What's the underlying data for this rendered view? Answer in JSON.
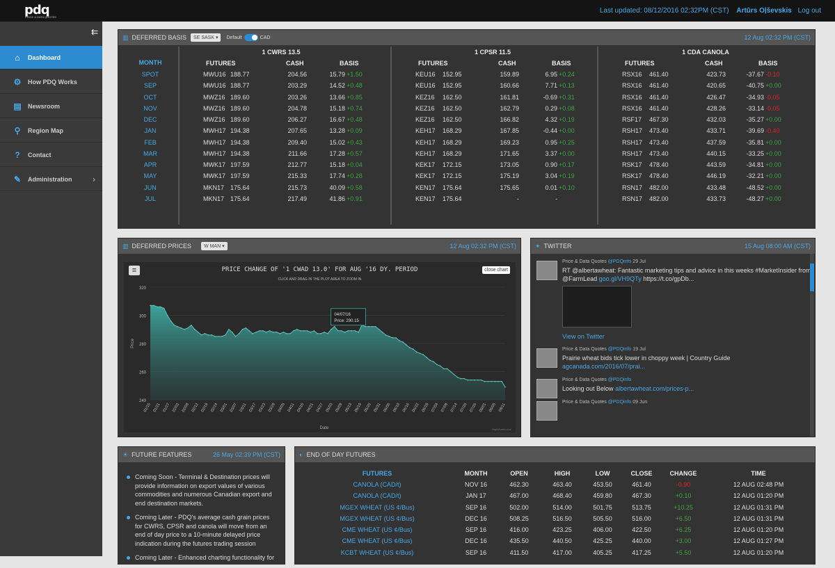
{
  "topbar": {
    "logo": "pdq",
    "logo_sub": "PRICE & DATA QUOTES",
    "last_updated": "Last updated: 08/12/2016 02:32PM (CST)",
    "user": "Artūrs Oļševskis",
    "logout": "Log out"
  },
  "nav": [
    {
      "label": "Dashboard",
      "icon": "home-icon"
    },
    {
      "label": "How PDQ Works",
      "icon": "gears-icon"
    },
    {
      "label": "Newsroom",
      "icon": "newspaper-icon"
    },
    {
      "label": "Region Map",
      "icon": "map-pin-icon"
    },
    {
      "label": "Contact",
      "icon": "question-icon"
    },
    {
      "label": "Administration",
      "icon": "wrench-icon"
    }
  ],
  "basis": {
    "title": "DEFERRED BASIS",
    "region": "SE SASK",
    "toggle_left": "Default",
    "toggle_right": "CAD",
    "timestamp": "12 Aug 02:32 PM (CST)",
    "month_header": "MONTH",
    "months": [
      "SPOT",
      "SEP",
      "OCT",
      "NOV",
      "DEC",
      "JAN",
      "FEB",
      "MAR",
      "APR",
      "MAY",
      "JUN",
      "JUL"
    ],
    "groups": [
      {
        "name": "1 CWRS 13.5",
        "headers": [
          "FUTURES",
          "CASH",
          "BASIS"
        ],
        "rows": [
          [
            "MWU16",
            "188.77",
            "204.56",
            "15.79",
            "+1.50"
          ],
          [
            "MWU16",
            "188.77",
            "203.29",
            "14.52",
            "+0.48"
          ],
          [
            "MWZ16",
            "189.60",
            "203.26",
            "13.66",
            "+0.85"
          ],
          [
            "MWZ16",
            "189.60",
            "204.78",
            "15.18",
            "+0.74"
          ],
          [
            "MWZ16",
            "189.60",
            "206.27",
            "16.67",
            "+0.48"
          ],
          [
            "MWH17",
            "194.38",
            "207.65",
            "13.28",
            "+0.09"
          ],
          [
            "MWH17",
            "194.38",
            "209.40",
            "15.02",
            "+0.43"
          ],
          [
            "MWH17",
            "194.38",
            "211.66",
            "17.28",
            "+0.57"
          ],
          [
            "MWK17",
            "197.59",
            "212.77",
            "15.18",
            "+0.04"
          ],
          [
            "MWK17",
            "197.59",
            "215.33",
            "17.74",
            "+0.28"
          ],
          [
            "MKN17",
            "175.64",
            "215.73",
            "40.09",
            "+0.58"
          ],
          [
            "MKN17",
            "175.64",
            "217.49",
            "41.86",
            "+0.91"
          ]
        ]
      },
      {
        "name": "1 CPSR 11.5",
        "headers": [
          "FUTURES",
          "CASH",
          "BASIS"
        ],
        "rows": [
          [
            "KEU16",
            "152.95",
            "159.89",
            "6.95",
            "+0.24"
          ],
          [
            "KEU16",
            "152.95",
            "160.66",
            "7.71",
            "+0.13"
          ],
          [
            "KEZ16",
            "162.50",
            "161.81",
            "-0.69",
            "+0.31"
          ],
          [
            "KEZ16",
            "162.50",
            "162.79",
            "0.29",
            "+0.08"
          ],
          [
            "KEZ16",
            "162.50",
            "166.82",
            "4.32",
            "+0.19"
          ],
          [
            "KEH17",
            "168.29",
            "167.85",
            "-0.44",
            "+0.00"
          ],
          [
            "KEH17",
            "168.29",
            "169.23",
            "0.95",
            "+0.25"
          ],
          [
            "KEH17",
            "168.29",
            "171.65",
            "3.37",
            "+0.00"
          ],
          [
            "KEK17",
            "172.15",
            "173.05",
            "0.90",
            "+0.17"
          ],
          [
            "KEK17",
            "172.15",
            "175.19",
            "3.04",
            "+0.19"
          ],
          [
            "KEN17",
            "175.64",
            "175.65",
            "0.01",
            "+0.10"
          ],
          [
            "KEN17",
            "175.64",
            "-",
            "-",
            ""
          ]
        ]
      },
      {
        "name": "1 CDA CANOLA",
        "headers": [
          "FUTURES",
          "CASH",
          "BASIS"
        ],
        "rows": [
          [
            "RSX16",
            "461.40",
            "423.73",
            "-37.67",
            "-0.10"
          ],
          [
            "RSX16",
            "461.40",
            "420.65",
            "-40.75",
            "+0.00"
          ],
          [
            "RSX16",
            "461.40",
            "426.47",
            "-34.93",
            "-0.05"
          ],
          [
            "RSX16",
            "461.40",
            "428.26",
            "-33.14",
            "-0.05"
          ],
          [
            "RSF17",
            "467.30",
            "432.03",
            "-35.27",
            "+0.00"
          ],
          [
            "RSH17",
            "473.40",
            "433.71",
            "-39.69",
            "-0.40"
          ],
          [
            "RSH17",
            "473.40",
            "437.59",
            "-35.81",
            "+0.00"
          ],
          [
            "RSH17",
            "473.40",
            "440.15",
            "-33.25",
            "+0.00"
          ],
          [
            "RSK17",
            "478.40",
            "443.59",
            "-34.81",
            "+0.00"
          ],
          [
            "RSK17",
            "478.40",
            "446.19",
            "-32.21",
            "+0.00"
          ],
          [
            "RSN17",
            "482.00",
            "433.48",
            "-48.52",
            "+0.00"
          ],
          [
            "RSN17",
            "482.00",
            "433.73",
            "-48.27",
            "+0.00"
          ]
        ]
      }
    ]
  },
  "deferred": {
    "title": "DEFERRED PRICES",
    "region": "W MAN",
    "timestamp": "12 Aug 02:32 PM (CST)",
    "chart_title": "PRICE CHANGE OF '1 CWAD 13.0' FOR AUG '16 DY. PERIOD",
    "chart_sub": "CLICK AND DRAG IN THE PLOT AREA TO ZOOM IN",
    "close_btn": "close chart",
    "credit": "Highcharts.com",
    "tooltip_date": "04/07/16",
    "tooltip_price": "Price: 290.15"
  },
  "chart_data": {
    "type": "area",
    "ylabel": "Price",
    "xlabel": "Date",
    "ylim": [
      240,
      320
    ],
    "yticks": [
      240,
      260,
      280,
      300,
      320
    ],
    "xticks": [
      "01/15",
      "01/21",
      "01/27",
      "02/02",
      "02/08",
      "02/12",
      "02/18",
      "02/24",
      "03/01",
      "03/07",
      "03/11",
      "03/17",
      "03/23",
      "03/29",
      "04/05",
      "04/11",
      "04/15",
      "04/21",
      "04/27",
      "05/03",
      "05/09",
      "05/13",
      "05/19",
      "05/25",
      "05/31",
      "06/06",
      "06/10",
      "06/16",
      "06/22",
      "06/28",
      "07/04",
      "07/08",
      "07/14",
      "07/20",
      "07/26",
      "08/01",
      "08/05",
      "08/11"
    ],
    "x": [
      0,
      2,
      4,
      6,
      8,
      10,
      12,
      14,
      16,
      18,
      20,
      22,
      24,
      26,
      28,
      30,
      32,
      34,
      36,
      38,
      40,
      42,
      44,
      46,
      48,
      50,
      52,
      54,
      56,
      58,
      60,
      62,
      64,
      66,
      68,
      70,
      72,
      74,
      76,
      78,
      80,
      82,
      84,
      86,
      88,
      90,
      92,
      94,
      96,
      98,
      100,
      102,
      104,
      106,
      108,
      110,
      112,
      114,
      116,
      118,
      120,
      122,
      124,
      126,
      128,
      130,
      132,
      134,
      136,
      138,
      140,
      142,
      144,
      146,
      148,
      150,
      152,
      154,
      156,
      158,
      160,
      162,
      164,
      166,
      168,
      170,
      172,
      174,
      176,
      178,
      180,
      182,
      184,
      186,
      188,
      190,
      192,
      194,
      196,
      198,
      200,
      202,
      204,
      206,
      208
    ],
    "values": [
      307,
      307,
      306,
      306,
      305,
      300,
      296,
      293,
      292,
      291,
      290,
      291,
      293,
      290,
      288,
      286,
      287,
      286,
      286,
      285,
      285,
      285,
      286,
      290,
      288,
      285,
      287,
      290,
      291,
      289,
      287,
      288,
      289,
      289,
      288,
      289,
      288,
      288,
      287,
      288,
      287,
      287,
      289,
      290,
      289,
      289,
      289,
      288,
      289,
      287,
      287,
      288,
      287,
      290,
      292,
      289,
      289,
      288,
      289,
      289,
      289,
      288,
      293,
      292,
      292,
      292,
      292,
      290,
      288,
      286,
      285,
      284,
      284,
      282,
      281,
      279,
      277,
      276,
      274,
      273,
      272,
      270,
      268,
      267,
      265,
      264,
      262,
      262,
      260,
      258,
      256,
      255,
      255,
      254,
      254,
      254,
      254,
      254,
      253,
      253,
      253,
      253,
      253,
      253,
      249
    ]
  },
  "twitter": {
    "title": "TWITTER",
    "timestamp": "15 Aug 08:00 AM (CST)",
    "tweets": [
      {
        "name": "Price & Data Quotes",
        "handle": "@PDQinfo",
        "date": "29 Jul",
        "text": "RT @albertawheat: Fantastic marketing tips and advice in this weeks #MarketInsider from @FarmLead ",
        "link": "goo.gl/VH9QTy",
        "tail": " https://t.co/gpDb...",
        "view": "View on Twitter"
      },
      {
        "name": "Price & Data Quotes",
        "handle": "@PDQinfo",
        "date": "19 Jul",
        "text": "Prairie wheat bids tick lower in choppy week | Country Guide ",
        "link": "agcanada.com/2016/07/prai..."
      },
      {
        "name": "Price & Data Quotes",
        "handle": "@PDQinfo",
        "date": "",
        "text": "Looking out Below ",
        "link": "albertawheat.com/prices-p..."
      },
      {
        "name": "Price & Data Quotes",
        "handle": "@PDQinfo",
        "date": "09 Jun",
        "text": "",
        "link": ""
      }
    ]
  },
  "future": {
    "title": "FUTURE FEATURES",
    "timestamp": "26 May 02:39 PM (CST)",
    "items": [
      "Coming Soon - Terminal & Destination prices will provide information on export values of various commodities and numerous Canadian export and end destination markets.",
      "Coming Later - PDQ's average cash grain prices for CWRS, CPSR and canola will move from an end of day price to a 10-minute delayed price indication during the futures trading session",
      "Coming Later - Enhanced charting functionality for"
    ]
  },
  "eod": {
    "title": "END OF DAY FUTURES",
    "headers": [
      "FUTURES",
      "MONTH",
      "OPEN",
      "HIGH",
      "LOW",
      "CLOSE",
      "CHANGE",
      "TIME"
    ],
    "rows": [
      [
        "CANOLA (CAD/t)",
        "NOV 16",
        "462.30",
        "463.40",
        "453.50",
        "461.40",
        "-0.90",
        "12 AUG 02:48 PM"
      ],
      [
        "CANOLA (CAD/t)",
        "JAN 17",
        "467.00",
        "468.40",
        "459.80",
        "467.30",
        "+0.10",
        "12 AUG 01:20 PM"
      ],
      [
        "MGEX WHEAT (US ¢/Bus)",
        "SEP 16",
        "502.00",
        "514.00",
        "501.75",
        "513.75",
        "+10.25",
        "12 AUG 01:31 PM"
      ],
      [
        "MGEX WHEAT (US ¢/Bus)",
        "DEC 16",
        "508.25",
        "516.50",
        "505.50",
        "516.00",
        "+6.50",
        "12 AUG 01:31 PM"
      ],
      [
        "CME WHEAT (US ¢/Bus)",
        "SEP 16",
        "416.00",
        "423.25",
        "406.00",
        "422.50",
        "+6.25",
        "12 AUG 01:20 PM"
      ],
      [
        "CME WHEAT (US ¢/Bus)",
        "DEC 16",
        "435.50",
        "440.50",
        "425.25",
        "440.00",
        "+3.00",
        "12 AUG 01:27 PM"
      ],
      [
        "KCBT WHEAT (US ¢/Bus)",
        "SEP 16",
        "411.50",
        "417.00",
        "405.25",
        "417.25",
        "+5.50",
        "12 AUG 01:20 PM"
      ]
    ]
  }
}
